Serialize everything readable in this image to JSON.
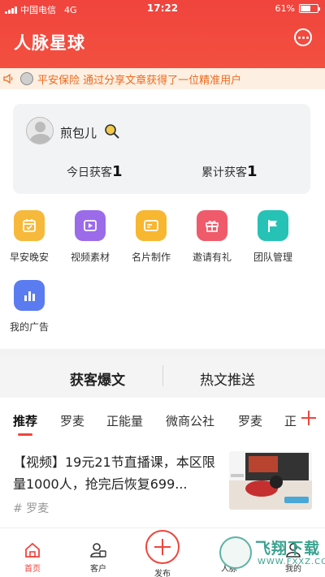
{
  "status_bar": {
    "carrier": "中国电信",
    "network": "4G",
    "time": "17:22",
    "battery": "61%",
    "battery_level": 0.61
  },
  "header": {
    "title": "人脉星球",
    "chat_icon": "chat-bubble-icon"
  },
  "notice": {
    "text": "平安保险 通过分享文章获得了一位精准用户",
    "icon": "speaker-icon"
  },
  "user": {
    "name": "煎包儿",
    "stats": [
      {
        "label": "今日获客",
        "value": "1"
      },
      {
        "label": "累计获客",
        "value": "1"
      }
    ]
  },
  "features": [
    {
      "label": "早安晚安",
      "icon": "calendar-icon",
      "color": "#f6b93b"
    },
    {
      "label": "视频素材",
      "icon": "play-icon",
      "color": "#9b6bea"
    },
    {
      "label": "名片制作",
      "icon": "card-icon",
      "color": "#f7b731"
    },
    {
      "label": "邀请有礼",
      "icon": "gift-icon",
      "color": "#ef5b6b"
    },
    {
      "label": "团队管理",
      "icon": "flag-icon",
      "color": "#26c2b6"
    },
    {
      "label": "我的广告",
      "icon": "bar-chart-icon",
      "color": "#5b7cf0"
    }
  ],
  "section_tabs": [
    {
      "label": "获客爆文",
      "active": true
    },
    {
      "label": "热文推送",
      "active": false
    }
  ],
  "categories": [
    "推荐",
    "罗麦",
    "正能量",
    "微商公社",
    "罗麦",
    "正"
  ],
  "article": {
    "title": "【视频】19元21节直播课，本区限量1000人，抢完后恢复699...",
    "tag": "# 罗麦"
  },
  "bottom_nav": [
    {
      "label": "首页",
      "icon": "home-icon",
      "active": true
    },
    {
      "label": "客户",
      "icon": "customers-icon",
      "active": false
    },
    {
      "label": "发布",
      "icon": "plus-icon",
      "active": false
    },
    {
      "label": "人脉",
      "icon": "contacts-icon",
      "active": false
    },
    {
      "label": "我的",
      "icon": "profile-icon",
      "active": false
    }
  ],
  "watermark": {
    "text": "飞翔下载",
    "sub": "WWW.FXXZ.COM"
  },
  "colors": {
    "brand_red": "#f0443d",
    "notice_orange": "#ee6a1e",
    "notice_bg": "#fdf0e3"
  }
}
